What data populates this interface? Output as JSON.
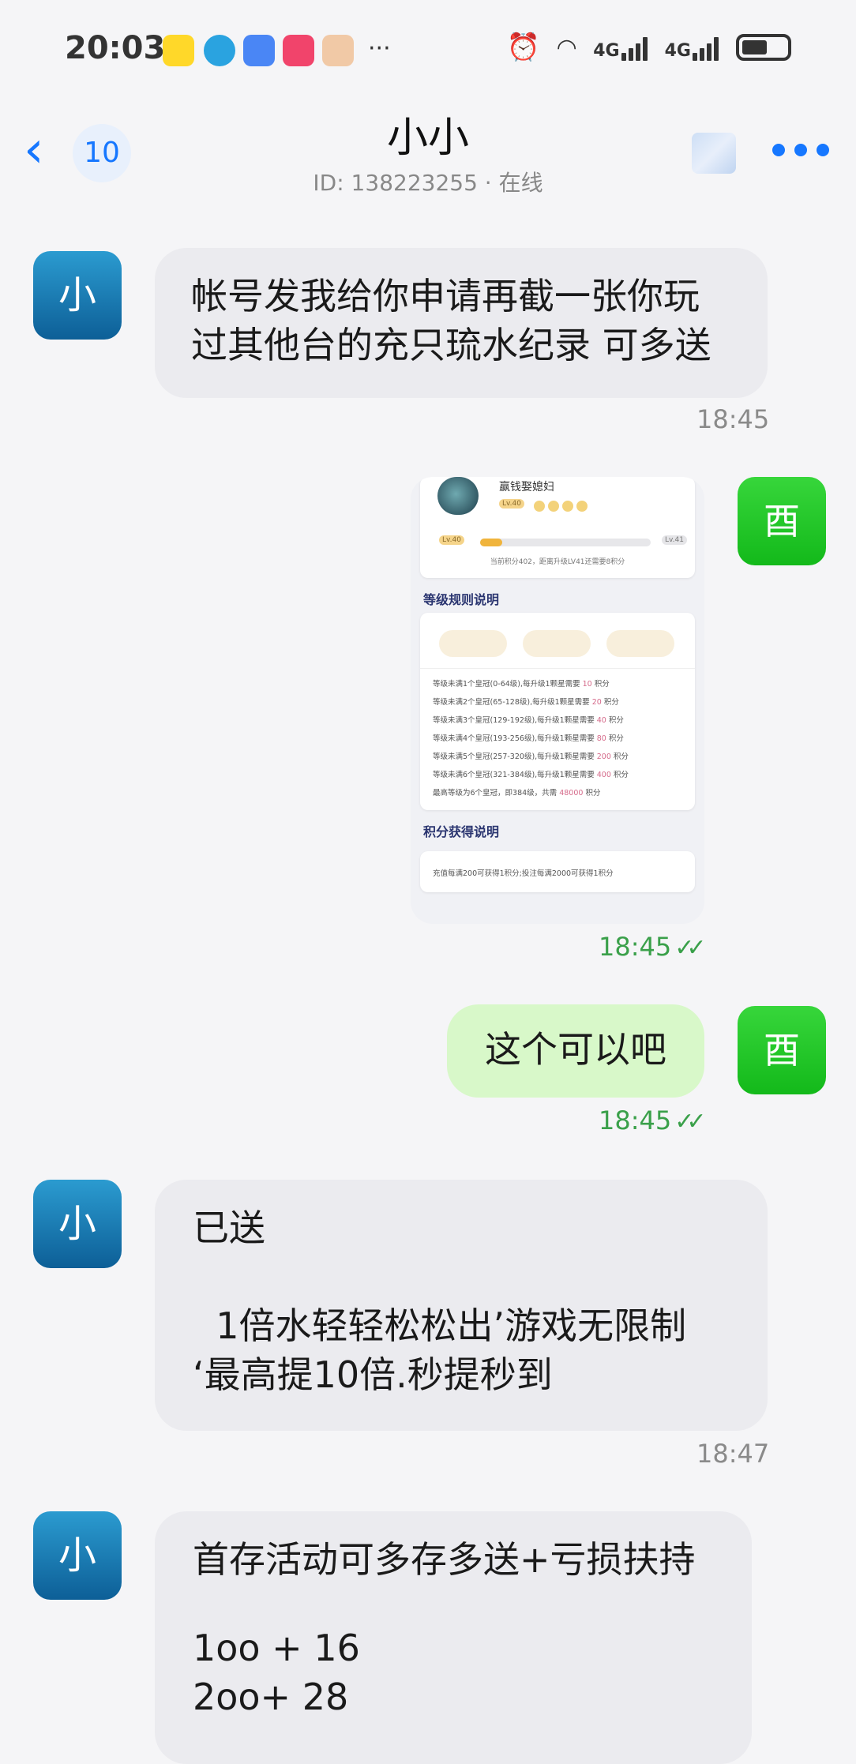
{
  "status": {
    "time": "20:03",
    "network_1": "4G",
    "network_2": "4G"
  },
  "header": {
    "back_count": "10",
    "title": "小小",
    "subtitle": "ID: 138223255 · 在线"
  },
  "contact_avatar_text": "小",
  "self_avatar_text": "酉",
  "messages": [
    {
      "text": "帐号发我给你申请再截一张你玩过其他台的充只琉水纪录 可多送",
      "line1": "帐号发我给你申请再截一张你玩",
      "line2": "过其他台的充只琉水纪录 可多送",
      "time": "18:45"
    },
    {
      "time": "18:45",
      "image": {
        "name": "赢钱娶媳妇",
        "level": "Lv.40",
        "progress_left": "Lv.40",
        "progress_right": "Lv.41",
        "progress_fraction": 0.13,
        "progress_text": "当前积分402，距离升级LV41还需要8积分",
        "section1": "等级规则说明",
        "rules": [
          {
            "text": "等级未满1个皇冠(0-64级),每升级1颗星需要 ",
            "value": "10",
            "unit": " 积分"
          },
          {
            "text": "等级未满2个皇冠(65-128级),每升级1颗星需要 ",
            "value": "20",
            "unit": " 积分"
          },
          {
            "text": "等级未满3个皇冠(129-192级),每升级1颗星需要 ",
            "value": "40",
            "unit": " 积分"
          },
          {
            "text": "等级未满4个皇冠(193-256级),每升级1颗星需要 ",
            "value": "80",
            "unit": " 积分"
          },
          {
            "text": "等级未满5个皇冠(257-320级),每升级1颗星需要 ",
            "value": "200",
            "unit": " 积分"
          },
          {
            "text": "等级未满6个皇冠(321-384级),每升级1颗星需要 ",
            "value": "400",
            "unit": " 积分"
          },
          {
            "text": "最高等级为6个皇冠，即384级，共需 ",
            "value": "48000",
            "unit": " 积分"
          }
        ],
        "section2": "积分获得说明",
        "points_text": "充值每满200可获得1积分;投注每满2000可获得1积分"
      }
    },
    {
      "text": "这个可以吧",
      "time": "18:45"
    },
    {
      "line1": "已送",
      "line2": "  1倍水轻轻松松出’游戏无限制",
      "line3": "‘最高提10倍.秒提秒到",
      "time": "18:47"
    },
    {
      "line1": "首存活动可多存多送+亏损扶持",
      "line2": "1oo + 16",
      "line3": "2oo+ 28"
    }
  ]
}
